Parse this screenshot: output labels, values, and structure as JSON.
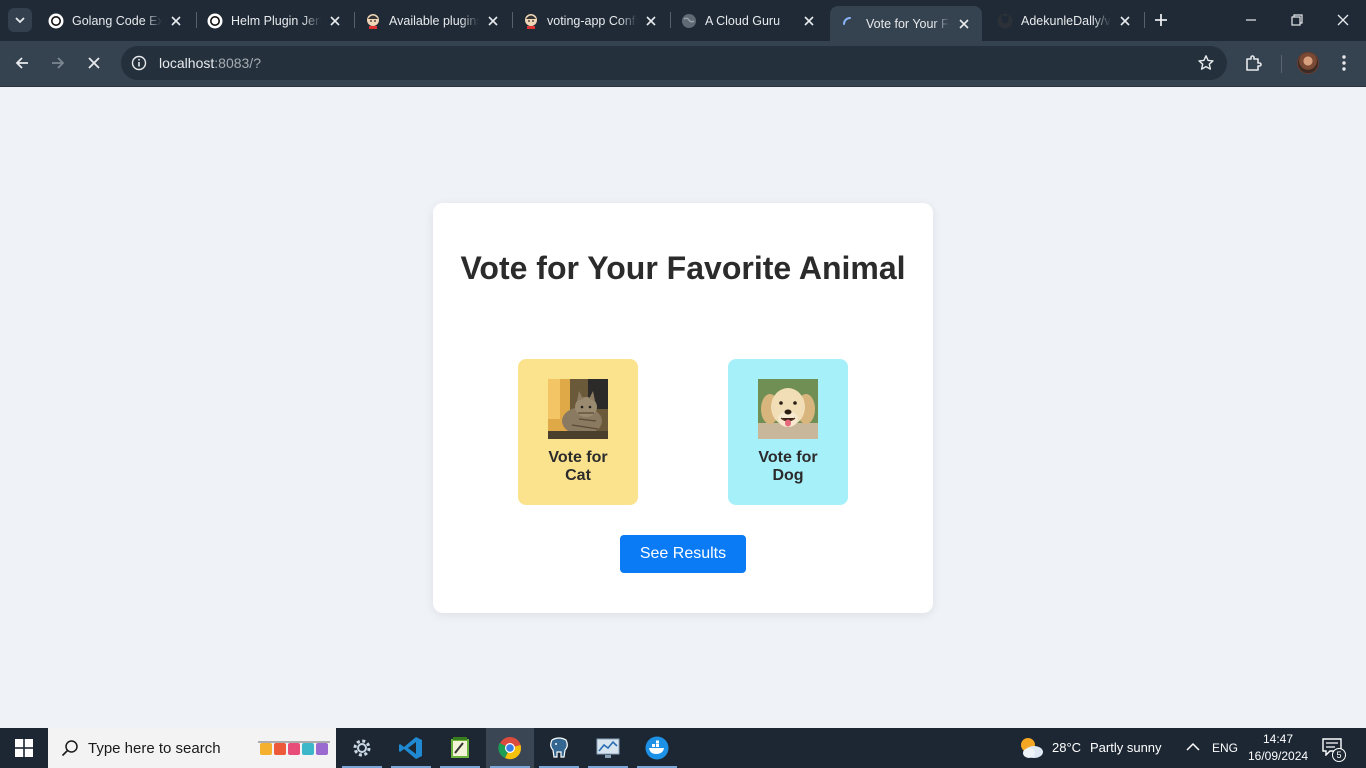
{
  "browser": {
    "tabs": [
      {
        "title": "Golang Code Explainer",
        "icon": "openai-icon"
      },
      {
        "title": "Helm Plugin Jenkins",
        "icon": "openai-icon"
      },
      {
        "title": "Available plugins",
        "icon": "jenkins-icon"
      },
      {
        "title": "voting-app Config",
        "icon": "jenkins-icon"
      },
      {
        "title": "A Cloud Guru",
        "icon": "globe-icon"
      },
      {
        "title": "Vote for Your Favorite Animal",
        "icon": "loading-spinner-icon"
      },
      {
        "title": "AdekunleDally/voting-app",
        "icon": "github-icon"
      }
    ],
    "url_host": "localhost",
    "url_rest": ":8083/?"
  },
  "page": {
    "title": "Vote for Your Favorite Animal",
    "cat_label": "Vote for Cat",
    "dog_label": "Vote for Dog",
    "results_label": "See Results"
  },
  "taskbar": {
    "search_placeholder": "Type here to search",
    "weather_temp": "28°C",
    "weather_text": "Partly sunny",
    "language": "ENG",
    "time": "14:47",
    "date": "16/09/2024",
    "notification_count": "5"
  },
  "colors": {
    "cat_card": "#fbe38e",
    "dog_card": "#a6f0fa",
    "button": "#0b7bf5"
  }
}
